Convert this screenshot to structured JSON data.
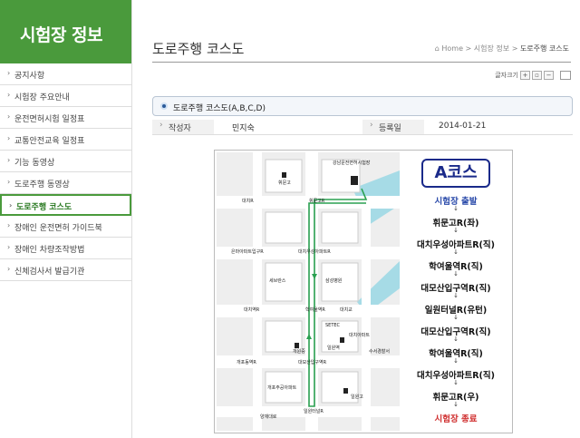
{
  "sidebar": {
    "title": "시험장 정보",
    "items": [
      {
        "label": "공지사항"
      },
      {
        "label": "시험장 주요안내"
      },
      {
        "label": "운전면허시험 일정표"
      },
      {
        "label": "교통안전교육 일정표"
      },
      {
        "label": "기능 동영상"
      },
      {
        "label": "도로주행 동영상"
      },
      {
        "label": "도로주행 코스도"
      },
      {
        "label": "장애인 운전면허 가이드북"
      },
      {
        "label": "장애인 차량조작방법"
      },
      {
        "label": "신체검사서 발급기관"
      }
    ],
    "active_index": 6
  },
  "header": {
    "title": "도로주행 코스도",
    "breadcrumb": {
      "home": "Home",
      "sep": ">",
      "parent": "시험장 정보",
      "current": "도로주행 코스도"
    }
  },
  "toolbar": {
    "font_label": "글자크기",
    "plus": "+",
    "reset": "▫",
    "minus": "−"
  },
  "post": {
    "title": "도로주행 코스도(A,B,C,D)",
    "author_label": "작성자",
    "author": "민지숙",
    "date_label": "등록일",
    "date": "2014-01-21"
  },
  "course": {
    "name": "A코스",
    "steps": [
      "시험장 출발",
      "휘문고R(좌)",
      "대치우성아파트R(직)",
      "학여울역R(직)",
      "대모산입구역R(직)",
      "일원터널R(유턴)",
      "대모산입구역R(직)",
      "학여울역R(직)",
      "대치우성아파트R(직)",
      "휘문고R(우)",
      "시험장 종료"
    ],
    "arrow": "↓",
    "map_labels": [
      "강남운전면허시험장",
      "휘문고R",
      "대치R",
      "휘문고",
      "은마아파트입구R",
      "대치우성아파트R",
      "학여울역R",
      "대치역R",
      "대치교",
      "대모산입구역R",
      "개포동역R",
      "일원터널R",
      "양재대로",
      "SETEC",
      "일원역",
      "수서경찰서",
      "대치아파트",
      "개원중",
      "개포주공아파트",
      "일원고",
      "세브란스",
      "삼성병원"
    ]
  },
  "colors": {
    "brand_green": "#4a9a3c",
    "route_green": "#2aa050",
    "course_blue": "#1a2a8a",
    "end_red": "#d03030"
  }
}
